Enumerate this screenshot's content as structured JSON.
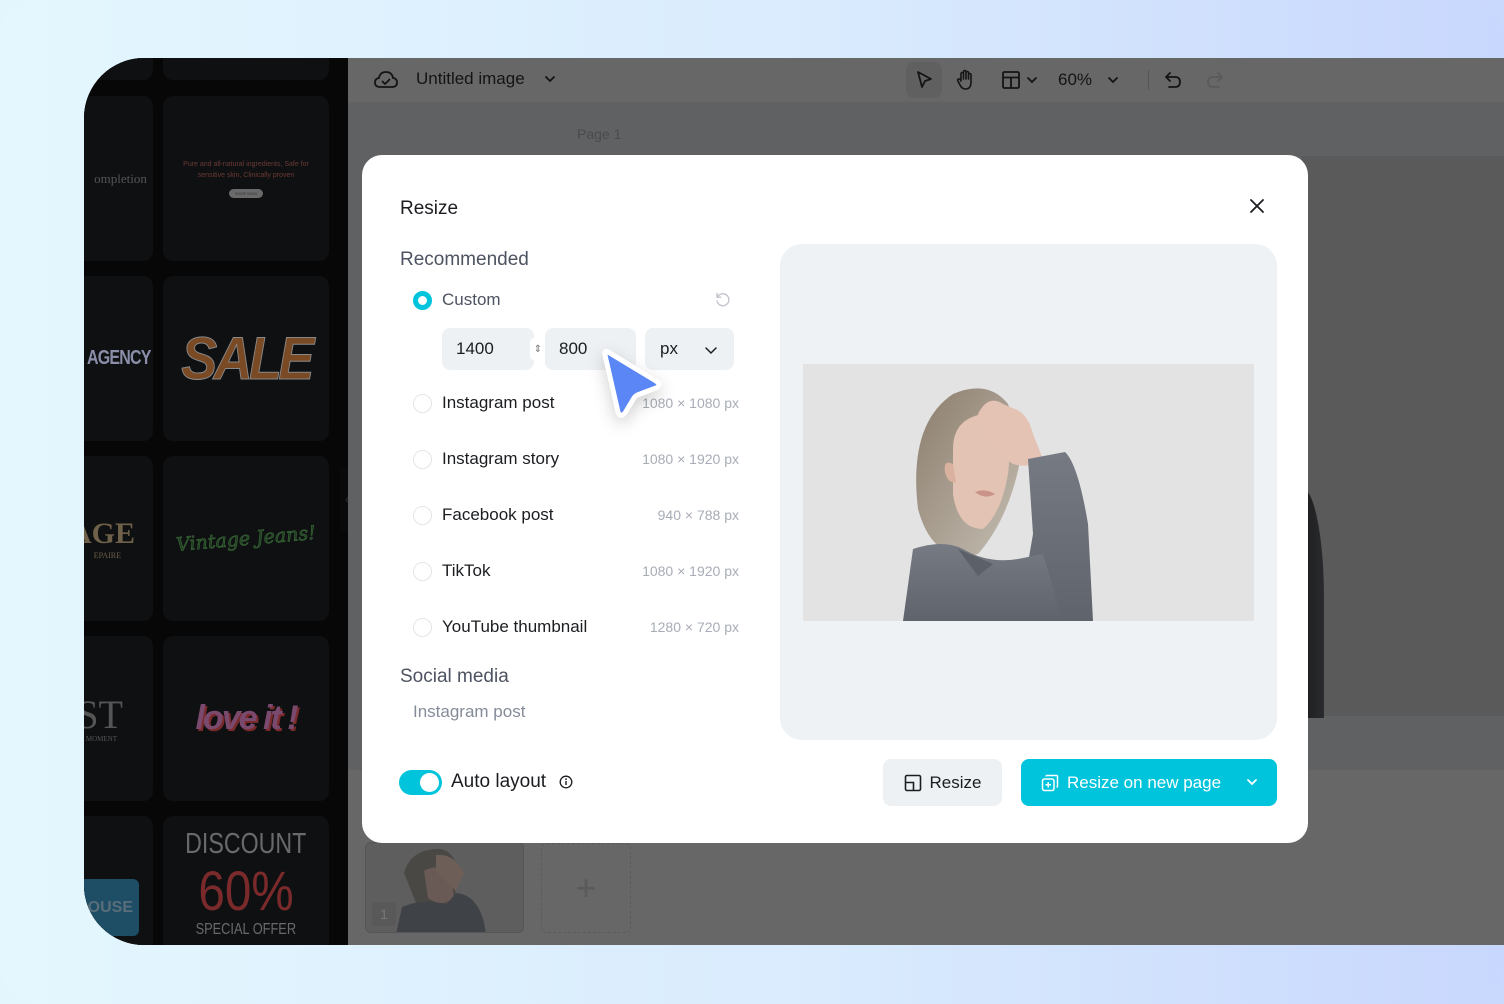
{
  "topbar": {
    "document_title": "Untitled image",
    "zoom_level": "60%",
    "page_label": "Page 1"
  },
  "sidebar": {
    "templates": [
      {
        "text": "ompletion",
        "subtext": "",
        "color": "#4a4a4a"
      },
      {
        "text": "Pure and all-natural ingredients, Safe for sensitive skin, Clinically proven",
        "subtext": "SHOP NOW",
        "color": "#6b3a35"
      },
      {
        "text": "AGENCY",
        "subtext": "",
        "color": "#8a8ea8"
      },
      {
        "text": "SALE",
        "subtext": "",
        "color": "#7a4a25"
      },
      {
        "text": "AGE",
        "subtext": "EPAIRE",
        "color": "#6e6049"
      },
      {
        "text": "Vintage Jeans!",
        "subtext": "",
        "color": "#2d5a2d"
      },
      {
        "text": "ST",
        "subtext": "MOMENT",
        "color": "#555555"
      },
      {
        "text": "love it !",
        "subtext": "",
        "color": "#7a4a6e"
      },
      {
        "text": "OUSE",
        "subtext": "",
        "color": "#1e4d66"
      },
      {
        "text": "DISCOUNT",
        "subtext": "60%",
        "color": "#6a6a6a"
      }
    ],
    "footer_text": "SPECIAL OFFER"
  },
  "filmstrip": {
    "pages": [
      {
        "number": "1"
      }
    ],
    "add_page_icon": "plus-icon"
  },
  "modal": {
    "title": "Resize",
    "recommended_label": "Recommended",
    "custom_label": "Custom",
    "width_value": "1400",
    "height_value": "800",
    "unit": "px",
    "presets": [
      {
        "label": "Instagram post",
        "dimensions": "1080 × 1080 px",
        "selected": false
      },
      {
        "label": "Instagram story",
        "dimensions": "1080 × 1920 px",
        "selected": false
      },
      {
        "label": "Facebook post",
        "dimensions": "940 × 788 px",
        "selected": false
      },
      {
        "label": "TikTok",
        "dimensions": "1080 × 1920 px",
        "selected": false
      },
      {
        "label": "YouTube thumbnail",
        "dimensions": "1280 × 720 px",
        "selected": false
      }
    ],
    "social_media_label": "Social media",
    "social_media_items": [
      "Instagram post"
    ],
    "auto_layout_label": "Auto layout",
    "auto_layout_enabled": true,
    "resize_button": "Resize",
    "resize_new_page_button": "Resize on new page",
    "accent_color": "#00c4dc"
  }
}
